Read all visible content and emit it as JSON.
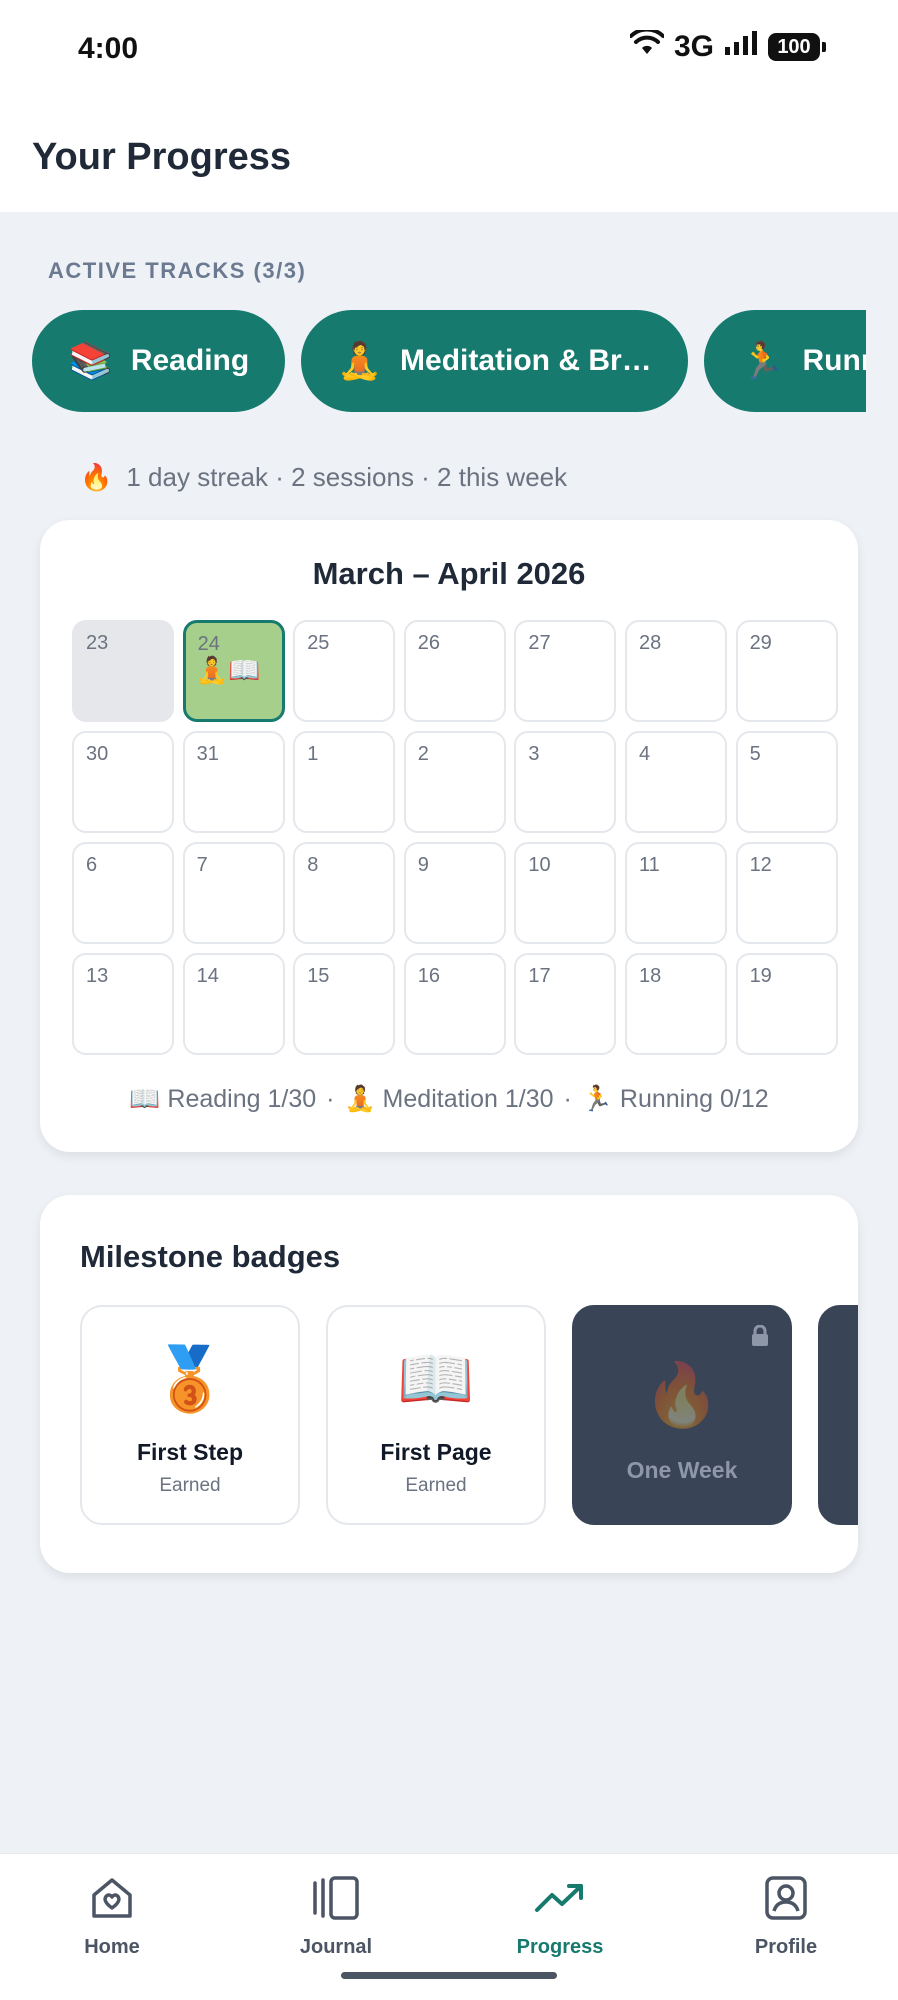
{
  "status_bar": {
    "time": "4:00",
    "network": "3G",
    "battery": "100"
  },
  "header": {
    "title": "Your Progress"
  },
  "active_tracks": {
    "label": "ACTIVE TRACKS (3/3)",
    "tracks": [
      {
        "emoji": "📚",
        "label": "Reading"
      },
      {
        "emoji": "🧘",
        "label": "Meditation & Br…"
      },
      {
        "emoji": "🏃",
        "label": "Running"
      }
    ]
  },
  "streak": {
    "emoji": "🔥",
    "text": "1 day streak · 2 sessions · 2 this week"
  },
  "calendar": {
    "title": "March – April 2026",
    "days": [
      {
        "num": "23",
        "state": "past",
        "marks": ""
      },
      {
        "num": "24",
        "state": "today",
        "marks": "🧘📖"
      },
      {
        "num": "25",
        "state": "future",
        "marks": ""
      },
      {
        "num": "26",
        "state": "future",
        "marks": ""
      },
      {
        "num": "27",
        "state": "future",
        "marks": ""
      },
      {
        "num": "28",
        "state": "future",
        "marks": ""
      },
      {
        "num": "29",
        "state": "future",
        "marks": ""
      },
      {
        "num": "30",
        "state": "future",
        "marks": ""
      },
      {
        "num": "31",
        "state": "future",
        "marks": ""
      },
      {
        "num": "1",
        "state": "future",
        "marks": ""
      },
      {
        "num": "2",
        "state": "future",
        "marks": ""
      },
      {
        "num": "3",
        "state": "future",
        "marks": ""
      },
      {
        "num": "4",
        "state": "future",
        "marks": ""
      },
      {
        "num": "5",
        "state": "future",
        "marks": ""
      },
      {
        "num": "6",
        "state": "future",
        "marks": ""
      },
      {
        "num": "7",
        "state": "future",
        "marks": ""
      },
      {
        "num": "8",
        "state": "future",
        "marks": ""
      },
      {
        "num": "9",
        "state": "future",
        "marks": ""
      },
      {
        "num": "10",
        "state": "future",
        "marks": ""
      },
      {
        "num": "11",
        "state": "future",
        "marks": ""
      },
      {
        "num": "12",
        "state": "future",
        "marks": ""
      },
      {
        "num": "13",
        "state": "future",
        "marks": ""
      },
      {
        "num": "14",
        "state": "future",
        "marks": ""
      },
      {
        "num": "15",
        "state": "future",
        "marks": ""
      },
      {
        "num": "16",
        "state": "future",
        "marks": ""
      },
      {
        "num": "17",
        "state": "future",
        "marks": ""
      },
      {
        "num": "18",
        "state": "future",
        "marks": ""
      },
      {
        "num": "19",
        "state": "future",
        "marks": ""
      }
    ],
    "legend": [
      {
        "text": "📖 Reading 1/30"
      },
      {
        "text": "🧘 Meditation 1/30"
      },
      {
        "text": "🏃 Running 0/12"
      }
    ],
    "legend_separator": "·"
  },
  "badges": {
    "title": "Milestone badges",
    "items": [
      {
        "emoji": "🥉",
        "title": "First Step",
        "status": "Earned",
        "locked": false
      },
      {
        "emoji": "📖",
        "title": "First Page",
        "status": "Earned",
        "locked": false
      },
      {
        "emoji": "🔥",
        "title": "One Week",
        "status": "",
        "locked": true
      },
      {
        "emoji": "",
        "title": "",
        "status": "",
        "locked": true
      }
    ]
  },
  "nav": {
    "items": [
      {
        "label": "Home",
        "icon": "home-heart-icon",
        "active": false
      },
      {
        "label": "Journal",
        "icon": "journal-icon",
        "active": false
      },
      {
        "label": "Progress",
        "icon": "trending-up-icon",
        "active": true
      },
      {
        "label": "Profile",
        "icon": "profile-icon",
        "active": false
      }
    ]
  },
  "colors": {
    "accent": "#167a6e",
    "today_fill": "#a6cf8c",
    "locked_badge": "#3a4457",
    "background": "#eef1f6"
  }
}
